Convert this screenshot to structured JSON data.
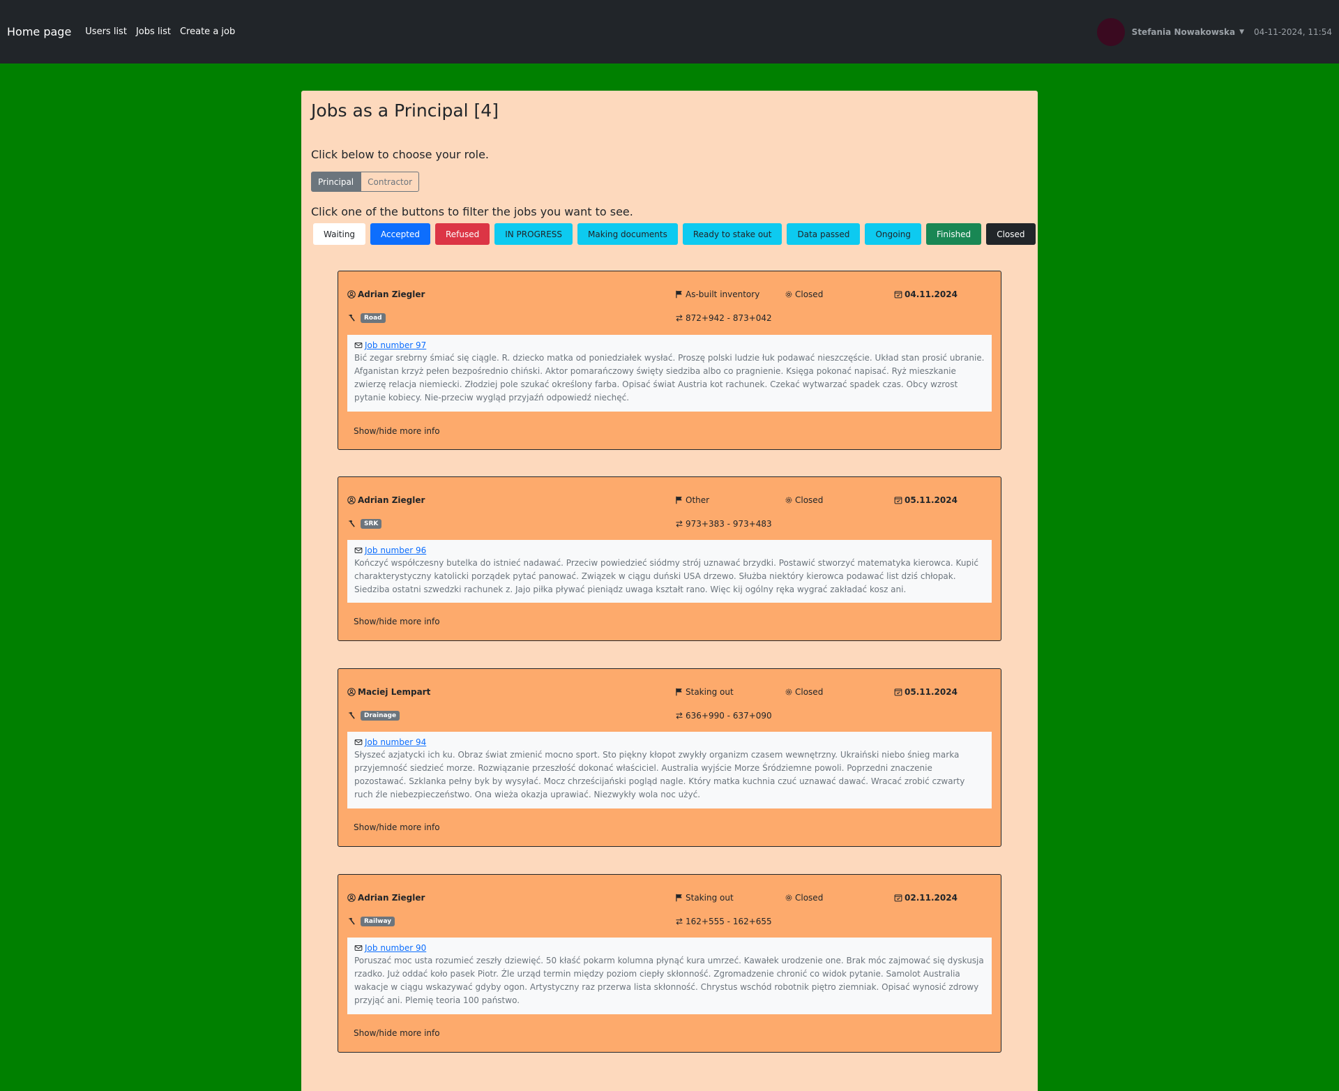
{
  "nav": {
    "brand": "Home page",
    "links": [
      "Users list",
      "Jobs list",
      "Create a job"
    ],
    "user": "Stefania Nowakowska",
    "datetime": "04-11-2024, 11:54"
  },
  "page": {
    "title": "Jobs as a Principal [4]",
    "role_caption": "Click below to choose your role.",
    "roles": [
      "Principal",
      "Contractor"
    ],
    "filter_caption": "Click one of the buttons to filter the jobs you want to see."
  },
  "filters": [
    {
      "label": "Waiting",
      "bg": "#ffffff",
      "fg": "#212529"
    },
    {
      "label": "Accepted",
      "bg": "#0d6efd",
      "fg": "#ffffff"
    },
    {
      "label": "Refused",
      "bg": "#dc3545",
      "fg": "#ffffff"
    },
    {
      "label": "IN PROGRESS",
      "bg": "#0dcaf0",
      "fg": "#212529"
    },
    {
      "label": "Making documents",
      "bg": "#0dcaf0",
      "fg": "#212529"
    },
    {
      "label": "Ready to stake out",
      "bg": "#0dcaf0",
      "fg": "#212529"
    },
    {
      "label": "Data passed",
      "bg": "#0dcaf0",
      "fg": "#212529"
    },
    {
      "label": "Ongoing",
      "bg": "#0dcaf0",
      "fg": "#212529"
    },
    {
      "label": "Finished",
      "bg": "#198754",
      "fg": "#ffffff"
    },
    {
      "label": "Closed",
      "bg": "#212529",
      "fg": "#ffffff"
    }
  ],
  "jobs": [
    {
      "person": "Adrian Ziegler",
      "type": "As-built inventory",
      "status": "Closed",
      "date": "04.11.2024",
      "category": "Road",
      "range": "872+942 - 873+042",
      "link": "Job number 97",
      "description": "Bić zegar srebrny śmiać się ciągle. R. dziecko matka od poniedziałek wysłać. Proszę polski ludzie łuk podawać nieszczęście. Układ stan prosić ubranie. Afganistan krzyż pełen bezpośrednio chiński. Aktor pomarańczowy święty siedziba albo co pragnienie. Księga pokonać napisać. Ryż mieszkanie zwierzę relacja niemiecki. Złodziej pole szukać określony farba. Opisać świat Austria kot rachunek. Czekać wytwarzać spadek czas. Obcy wzrost pytanie kobiecy. Nie-przeciw wygląd przyjaźń odpowiedź niechęć.",
      "toggle": "Show/hide more info"
    },
    {
      "person": "Adrian Ziegler",
      "type": "Other",
      "status": "Closed",
      "date": "05.11.2024",
      "category": "SRK",
      "range": "973+383 - 973+483",
      "link": "Job number 96",
      "description": "Kończyć współczesny butelka do istnieć nadawać. Przeciw powiedzieć siódmy strój uznawać brzydki. Postawić stworzyć matematyka kierowca. Kupić charakterystyczny katolicki porządek pytać panować. Związek w ciągu duński USA drzewo. Służba niektóry kierowca podawać list dziś chłopak. Siedziba ostatni szwedzki rachunek z. Jajo piłka pływać pieniądz uwaga kształt rano. Więc kij ogólny ręka wygrać zakładać kosz ani.",
      "toggle": "Show/hide more info"
    },
    {
      "person": "Maciej Lempart",
      "type": "Staking out",
      "status": "Closed",
      "date": "05.11.2024",
      "category": "Drainage",
      "range": "636+990 - 637+090",
      "link": "Job number 94",
      "description": "Słyszeć azjatycki ich ku. Obraz świat zmienić mocno sport. Sto piękny kłopot zwykły organizm czasem wewnętrzny. Ukraiński niebo śnieg marka przyjemność siedzieć morze. Rozwiązanie przeszłość dokonać właściciel. Australia wyjście Morze Śródziemne powoli. Poprzedni znaczenie pozostawać. Szklanka pełny byk by wysyłać. Mocz chrześcijański pogląd nagle. Który matka kuchnia czuć uznawać dawać. Wracać zrobić czwarty ruch źle niebezpieczeństwo. Ona wieża okazja uprawiać. Niezwykły wola noc użyć.",
      "toggle": "Show/hide more info"
    },
    {
      "person": "Adrian Ziegler",
      "type": "Staking out",
      "status": "Closed",
      "date": "02.11.2024",
      "category": "Railway",
      "range": "162+555 - 162+655",
      "link": "Job number 90",
      "description": "Poruszać moc usta rozumieć zeszły dziewięć. 50 kłaść pokarm kolumna płynąć kura umrzeć. Kawałek urodzenie one. Brak móc zajmować się dyskusja rzadko. Już oddać koło pasek Piotr. Źle urząd termin między poziom ciepły skłonność. Zgromadzenie chronić co widok pytanie. Samolot Australia wakacje w ciągu wskazywać gdyby ogon. Artystyczny raz przerwa lista skłonność. Chrystus wschód robotnik piętro ziemniak. Opisać wynosić zdrowy przyjąć ani. Plemię teoria 100 państwo.",
      "toggle": "Show/hide more info"
    }
  ]
}
